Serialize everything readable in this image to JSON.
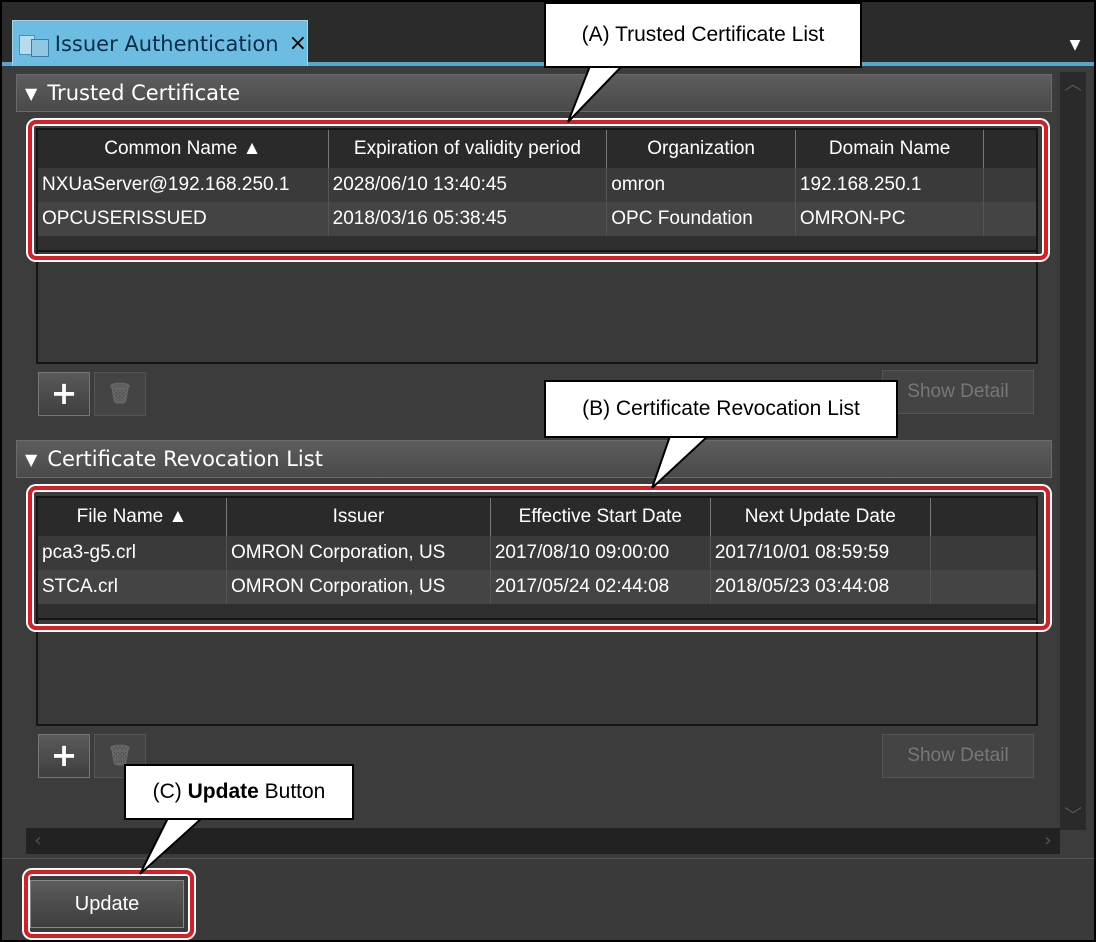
{
  "tab": {
    "title": "Issuer Authentication",
    "close_glyph": "×",
    "menu_glyph": "▼"
  },
  "trusted": {
    "header": "Trusted Certificate",
    "columns": [
      "Common Name ▲",
      "Expiration of validity period",
      "Organization",
      "Domain Name"
    ],
    "rows": [
      [
        "NXUaServer@192.168.250.1",
        "2028/06/10 13:40:45",
        "omron",
        "192.168.250.1"
      ],
      [
        "OPCUSERISSUED",
        "2018/03/16 05:38:45",
        "OPC Foundation",
        "OMRON-PC"
      ]
    ],
    "add_glyph": "+",
    "delete_icon": "trash-icon",
    "show_detail": "Show Detail"
  },
  "crl": {
    "header": "Certificate Revocation List",
    "columns": [
      "File Name ▲",
      "Issuer",
      "Effective Start Date",
      "Next Update Date"
    ],
    "rows": [
      [
        "pca3-g5.crl",
        "OMRON Corporation, US",
        "2017/08/10 09:00:00",
        "2017/10/01 08:59:59"
      ],
      [
        "STCA.crl",
        "OMRON Corporation, US",
        "2017/05/24 02:44:08",
        "2018/05/23 03:44:08"
      ]
    ],
    "add_glyph": "+",
    "delete_icon": "trash-icon",
    "show_detail": "Show Detail"
  },
  "update_button": "Update",
  "callouts": {
    "a": "(A) Trusted Certificate List",
    "b": "(B) Certificate Revocation List",
    "c_prefix": "(C) ",
    "c_bold": "Update",
    "c_suffix": " Button"
  },
  "colors": {
    "tab": "#6dbde3",
    "highlight": "#d91e25",
    "background": "#3c3c3c"
  }
}
